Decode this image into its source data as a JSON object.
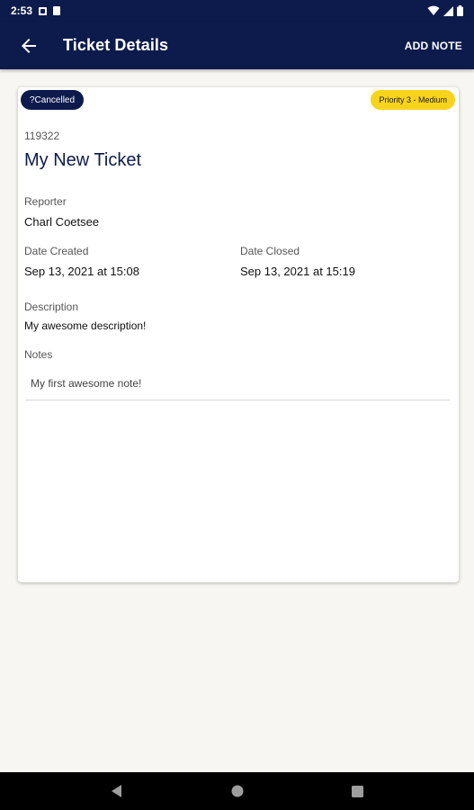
{
  "status_bar": {
    "time": "2:53",
    "icons": [
      "notification-icon",
      "sd-card-icon",
      "wifi-icon",
      "signal-icon",
      "battery-icon"
    ]
  },
  "app_bar": {
    "title": "Ticket Details",
    "action_label": "ADD NOTE",
    "back_icon": "arrow-back-icon"
  },
  "ticket": {
    "status": "?Cancelled",
    "priority": "Priority 3 - Medium",
    "id": "119322",
    "title": "My New Ticket",
    "reporter_label": "Reporter",
    "reporter": "Charl Coetsee",
    "date_created_label": "Date Created",
    "date_created": "Sep 13, 2021 at 15:08",
    "date_closed_label": "Date Closed",
    "date_closed": "Sep 13, 2021 at 15:19",
    "description_label": "Description",
    "description": "My awesome description!",
    "notes_label": "Notes",
    "notes": [
      "My first awesome note!"
    ]
  },
  "colors": {
    "primary": "#0d1b4c",
    "priority_chip": "#f7d31c",
    "background": "#f7f6f3"
  },
  "nav_bar": {
    "buttons": [
      "back-triangle-icon",
      "home-circle-icon",
      "recents-square-icon"
    ]
  }
}
